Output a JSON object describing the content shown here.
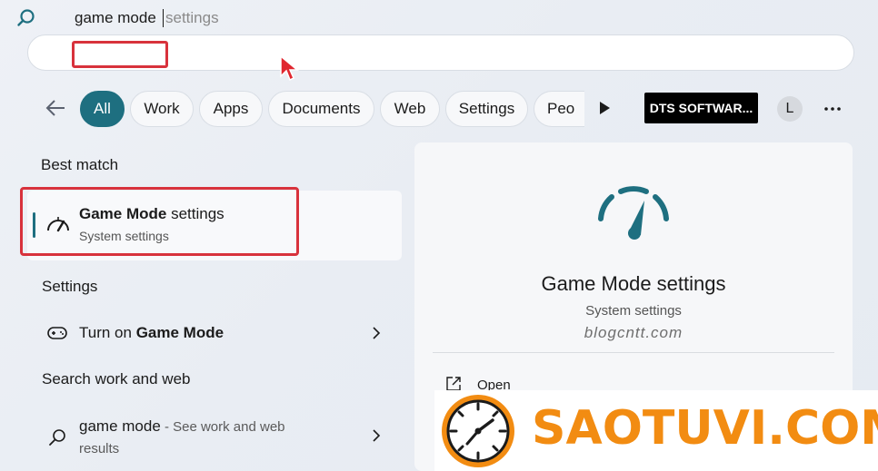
{
  "search": {
    "typed": "game mode",
    "suggestion": "settings"
  },
  "filters": {
    "chips": [
      "All",
      "Work",
      "Apps",
      "Documents",
      "Web",
      "Settings",
      "Peo"
    ],
    "org_label": "DTS SOFTWAR...",
    "avatar_letter": "L"
  },
  "left": {
    "best_match_header": "Best match",
    "best_match": {
      "title_bold": "Game Mode",
      "title_rest": " settings",
      "subtitle": "System settings"
    },
    "settings_header": "Settings",
    "settings_item": {
      "prefix": "Turn on ",
      "bold": "Game Mode"
    },
    "web_header": "Search work and web",
    "web_item": {
      "query": "game mode",
      "hint": " - See work and web",
      "hint2": "results"
    }
  },
  "right": {
    "title": "Game Mode settings",
    "subtitle": "System settings",
    "watermark": "blogcntt.com",
    "actions": [
      {
        "label": "Open",
        "icon": "open-icon"
      }
    ]
  },
  "brand": {
    "text": "SAOTUVI.COM"
  },
  "colors": {
    "accent": "#1e6f80",
    "highlight": "#d8323c",
    "brand_orange": "#f28c12"
  }
}
